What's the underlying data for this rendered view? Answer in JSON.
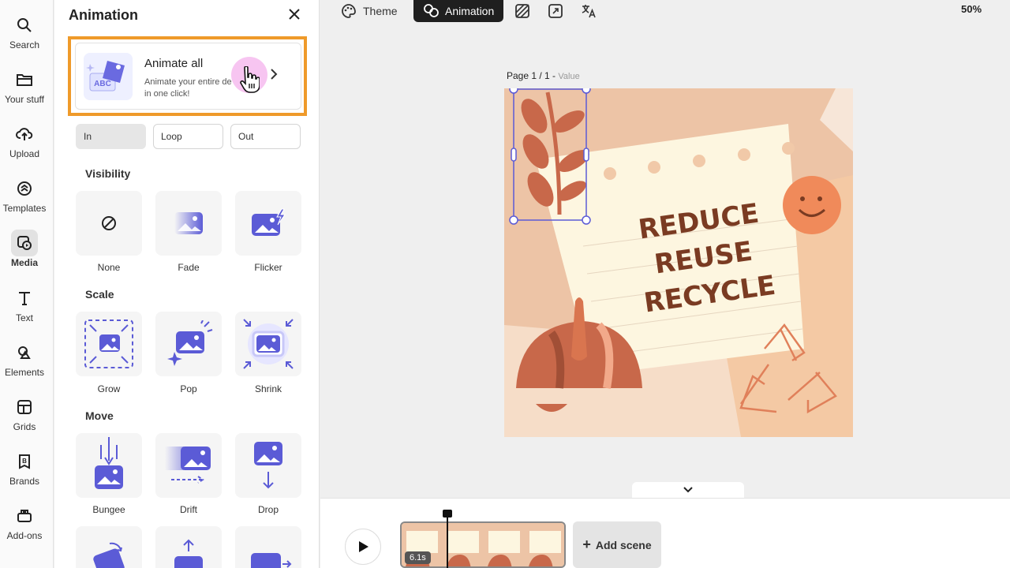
{
  "rail": {
    "items": [
      {
        "label": "Search",
        "icon": "search-icon"
      },
      {
        "label": "Your stuff",
        "icon": "folder-icon"
      },
      {
        "label": "Upload",
        "icon": "upload-icon"
      },
      {
        "label": "Templates",
        "icon": "templates-icon"
      },
      {
        "label": "Media",
        "icon": "media-icon",
        "active": true
      },
      {
        "label": "Text",
        "icon": "text-icon"
      },
      {
        "label": "Elements",
        "icon": "elements-icon"
      },
      {
        "label": "Grids",
        "icon": "grids-icon"
      },
      {
        "label": "Brands",
        "icon": "brands-icon"
      },
      {
        "label": "Add-ons",
        "icon": "addons-icon"
      }
    ]
  },
  "panel": {
    "title": "Animation",
    "animate_all": {
      "title": "Animate all",
      "desc_line1": "Animate your entire de",
      "desc_line2": "in one click!"
    },
    "tabs": [
      "In",
      "Loop",
      "Out"
    ],
    "sections": {
      "visibility": "Visibility",
      "scale": "Scale",
      "move": "Move"
    },
    "visibility_items": [
      "None",
      "Fade",
      "Flicker"
    ],
    "scale_items": [
      "Grow",
      "Pop",
      "Shrink"
    ],
    "move_items": [
      "Bungee",
      "Drift",
      "Drop"
    ]
  },
  "toolbar": {
    "theme": "Theme",
    "animation": "Animation",
    "zoom": "50%"
  },
  "canvas": {
    "page_label": "Page 1 / 1 - ",
    "page_value": "Value",
    "headline": [
      "REDUCE",
      "REUSE",
      "RECYCLE"
    ]
  },
  "timeline": {
    "duration": "6.1s",
    "add_scene": "Add scene"
  },
  "colors": {
    "accent_highlight": "#ef9a2a",
    "brand_purple": "#5b5bd6",
    "headline_brown": "#7a3b22"
  }
}
